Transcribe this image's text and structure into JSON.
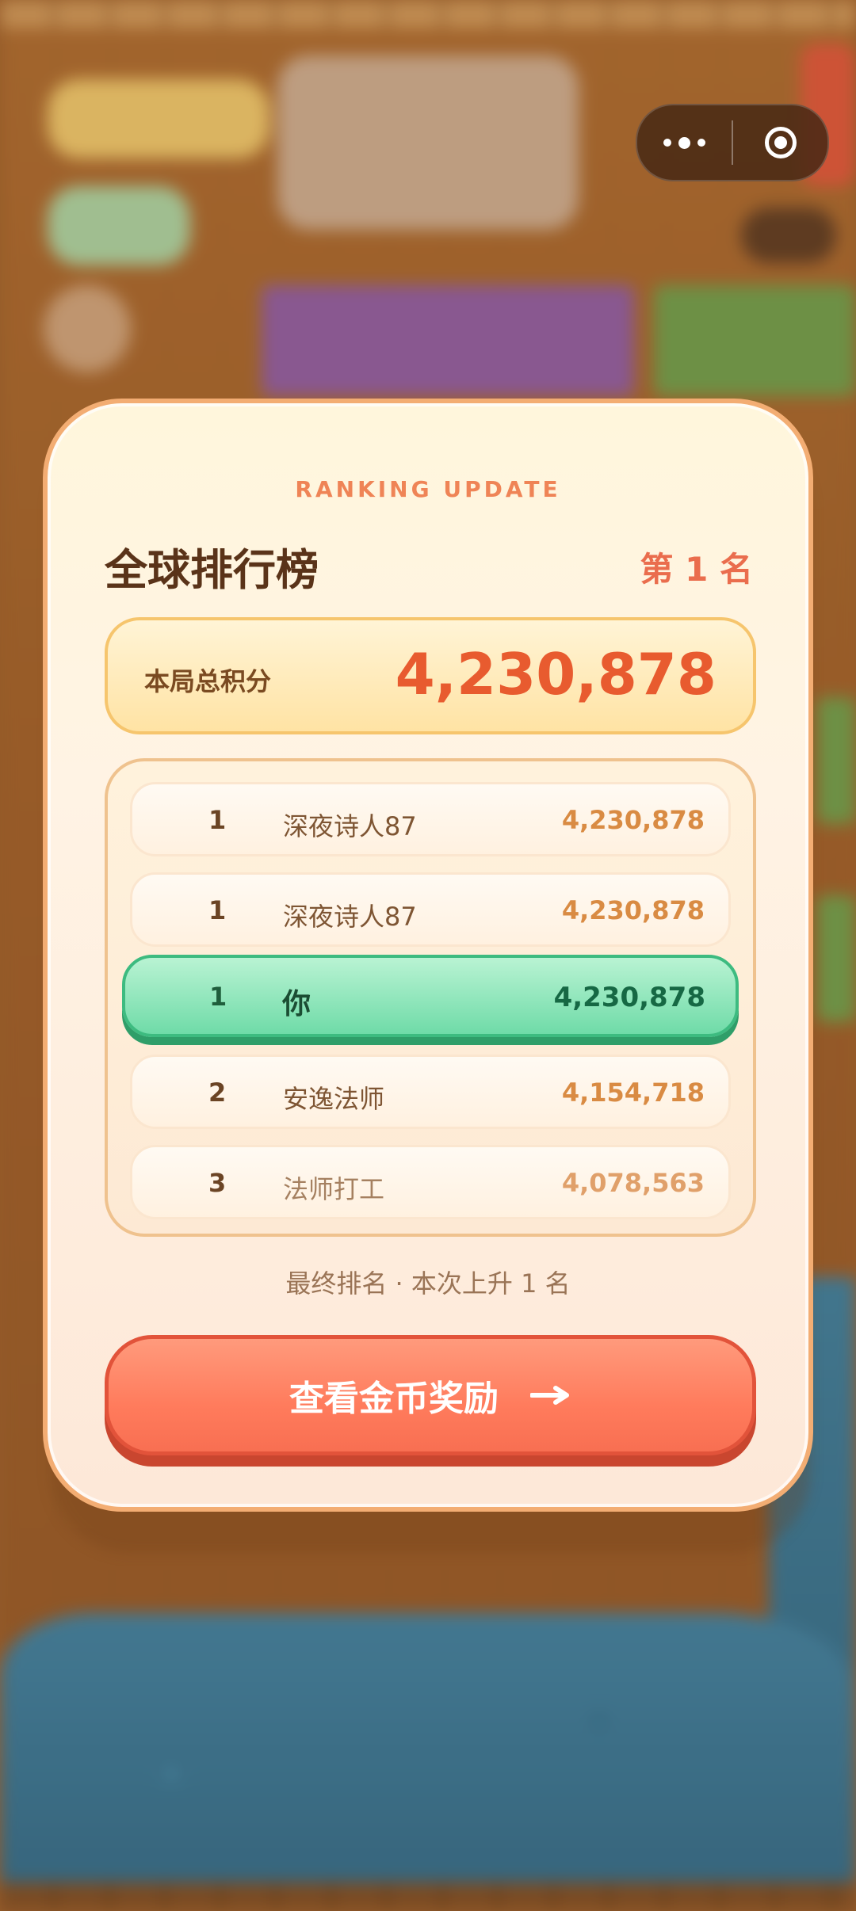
{
  "modal": {
    "kicker": "RANKING UPDATE",
    "title": "全球排行榜",
    "rank_label": "第 1 名",
    "total": {
      "label": "本局总积分",
      "value": "4,230,878"
    },
    "rows": [
      {
        "rank": "1",
        "name": "深夜诗人87",
        "score": "4,230,878"
      },
      {
        "rank": "1",
        "name": "深夜诗人87",
        "score": "4,230,878"
      },
      {
        "rank": "1",
        "name": "你",
        "score": "4,230,878"
      },
      {
        "rank": "2",
        "name": "安逸法师",
        "score": "4,154,718"
      },
      {
        "rank": "3",
        "name": "法师打工",
        "score": "4,078,563"
      }
    ],
    "note": "最终排名 · 本次上升 1 名",
    "cta_label": "查看金币奖励"
  },
  "icons": {
    "cta": "arrow-right-icon",
    "capsule_more": "more-dots-icon",
    "capsule_close": "target-circle-icon"
  },
  "colors": {
    "accent": "#e85b2f",
    "highlight_row": "#6fdba8",
    "cta": "#ff7b5c"
  }
}
